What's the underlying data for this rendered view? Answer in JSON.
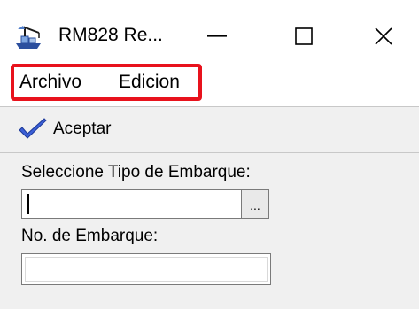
{
  "window": {
    "title": "RM828  Re...",
    "controls": {
      "minimize_icon": "minimize-icon",
      "maximize_icon": "maximize-icon",
      "close_icon": "close-icon"
    }
  },
  "menu": {
    "items": [
      {
        "label": "Archivo"
      },
      {
        "label": "Edicion"
      }
    ],
    "highlight_color": "#e8121c"
  },
  "toolbar": {
    "accept_label": "Aceptar",
    "accept_icon": "checkmark-icon",
    "accept_icon_color": "#3b5fd6"
  },
  "form": {
    "tipo_label": "Seleccione Tipo de Embarque:",
    "tipo_value": "",
    "browse_label": "...",
    "num_label": "No. de Embarque:",
    "num_value": ""
  }
}
